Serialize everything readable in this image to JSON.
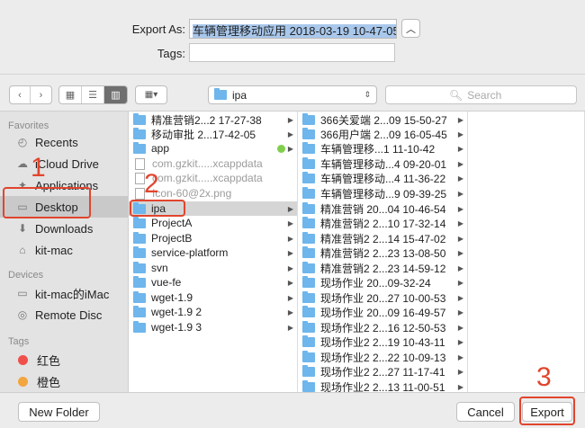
{
  "header": {
    "export_as_label": "Export As:",
    "export_as_value": "车辆管理移动应用 2018-03-19 10-47-05",
    "tags_label": "Tags:",
    "tags_value": ""
  },
  "toolbar": {
    "back_icon": "‹",
    "forward_icon": "›",
    "view_icons": [
      "▦",
      "☰",
      "▥"
    ],
    "group_icon": "▦▾",
    "location": "ipa",
    "search_placeholder": "Search"
  },
  "sidebar": {
    "favorites_header": "Favorites",
    "favorites": [
      {
        "label": "Recents",
        "icon": "clock-icon"
      },
      {
        "label": "iCloud Drive",
        "icon": "cloud-icon"
      },
      {
        "label": "Applications",
        "icon": "applications-icon"
      },
      {
        "label": "Desktop",
        "icon": "desktop-icon",
        "selected": true
      },
      {
        "label": "Downloads",
        "icon": "download-icon"
      },
      {
        "label": "kit-mac",
        "icon": "home-icon"
      }
    ],
    "devices_header": "Devices",
    "devices": [
      {
        "label": "kit-mac的iMac",
        "icon": "imac-icon"
      },
      {
        "label": "Remote Disc",
        "icon": "disc-icon"
      }
    ],
    "tags_header": "Tags",
    "tags": [
      {
        "label": "红色",
        "color": "#f0504a"
      },
      {
        "label": "橙色",
        "color": "#f3a540"
      }
    ]
  },
  "column1": [
    {
      "name": "精准营销2...2 17-27-38",
      "type": "folder"
    },
    {
      "name": "移动审批 2...17-42-05",
      "type": "folder"
    },
    {
      "name": "app",
      "type": "folder",
      "tag": "green"
    },
    {
      "name": "com.gzkit.....xcappdata",
      "type": "file"
    },
    {
      "name": "com.gzkit.....xcappdata",
      "type": "file"
    },
    {
      "name": "Icon-60@2x.png",
      "type": "file"
    },
    {
      "name": "ipa",
      "type": "folder",
      "selected": true
    },
    {
      "name": "ProjectA",
      "type": "folder"
    },
    {
      "name": "ProjectB",
      "type": "folder"
    },
    {
      "name": "service-platform",
      "type": "folder"
    },
    {
      "name": "svn",
      "type": "folder"
    },
    {
      "name": "vue-fe",
      "type": "folder"
    },
    {
      "name": "wget-1.9",
      "type": "folder"
    },
    {
      "name": "wget-1.9 2",
      "type": "folder"
    },
    {
      "name": "wget-1.9 3",
      "type": "folder"
    }
  ],
  "column2": [
    "366关爱端 2...09 15-50-27",
    "366用户端 2...09 16-05-45",
    "车辆管理移...1 11-10-42",
    "车辆管理移动...4 09-20-01",
    "车辆管理移动...4 11-36-22",
    "车辆管理移动...9 09-39-25",
    "精准营销 20...04 10-46-54",
    "精准营销2 2...10 17-32-14",
    "精准营销2 2...14 15-47-02",
    "精准营销2 2...23 13-08-50",
    "精准营销2 2...23 14-59-12",
    "现场作业 20...09-32-24",
    "现场作业 20...27 10-00-53",
    "现场作业 20...09 16-49-57",
    "现场作业2 2...16 12-50-53",
    "现场作业2 2...19 10-43-11",
    "现场作业2 2...22 10-09-13",
    "现场作业2 2...27 11-17-41",
    "现场作业2 2...13 11-00-51"
  ],
  "footer": {
    "new_folder_label": "New Folder",
    "cancel_label": "Cancel",
    "export_label": "Export"
  },
  "annotations": [
    "1",
    "2",
    "3"
  ],
  "colors": {
    "annotation": "#e1452d",
    "folder": "#6eb6ec",
    "selection_highlight": "#a9c8ec"
  }
}
